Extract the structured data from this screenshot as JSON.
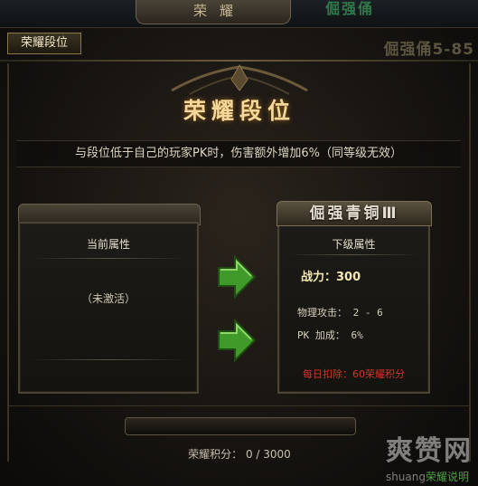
{
  "window": {
    "title": "荣耀",
    "tab_label": "荣耀段位",
    "bg_level_text": "倔强俑5-85",
    "bg_green_text": "倔强俑"
  },
  "banner": {
    "title": "荣耀段位",
    "description": "与段位低于自己的玩家PK时，伤害额外增加6%（同等级无效）"
  },
  "current": {
    "caption": "当前属性",
    "status": "（未激活）"
  },
  "next": {
    "rank_name": "倔强青铜Ⅲ",
    "caption": "下级属性",
    "power_label": "战力：300",
    "stats": [
      "物理攻击： 2 - 6",
      "PK  加成： 6%"
    ],
    "daily_deduct": "每日扣除：60荣耀积分"
  },
  "footer": {
    "points": "荣耀积分： 0 / 3000"
  },
  "watermark": {
    "main": "爽赞网",
    "sub_prefix": "shuang",
    "sub_green": "荣耀说明"
  },
  "colors": {
    "accent_gold": "#f4d79a",
    "arrow_green": "#3f9a2a",
    "deduct_red": "#d6342a"
  },
  "icons": [
    "arrow-right-icon",
    "arrow-right-icon",
    "ornament-icon"
  ]
}
